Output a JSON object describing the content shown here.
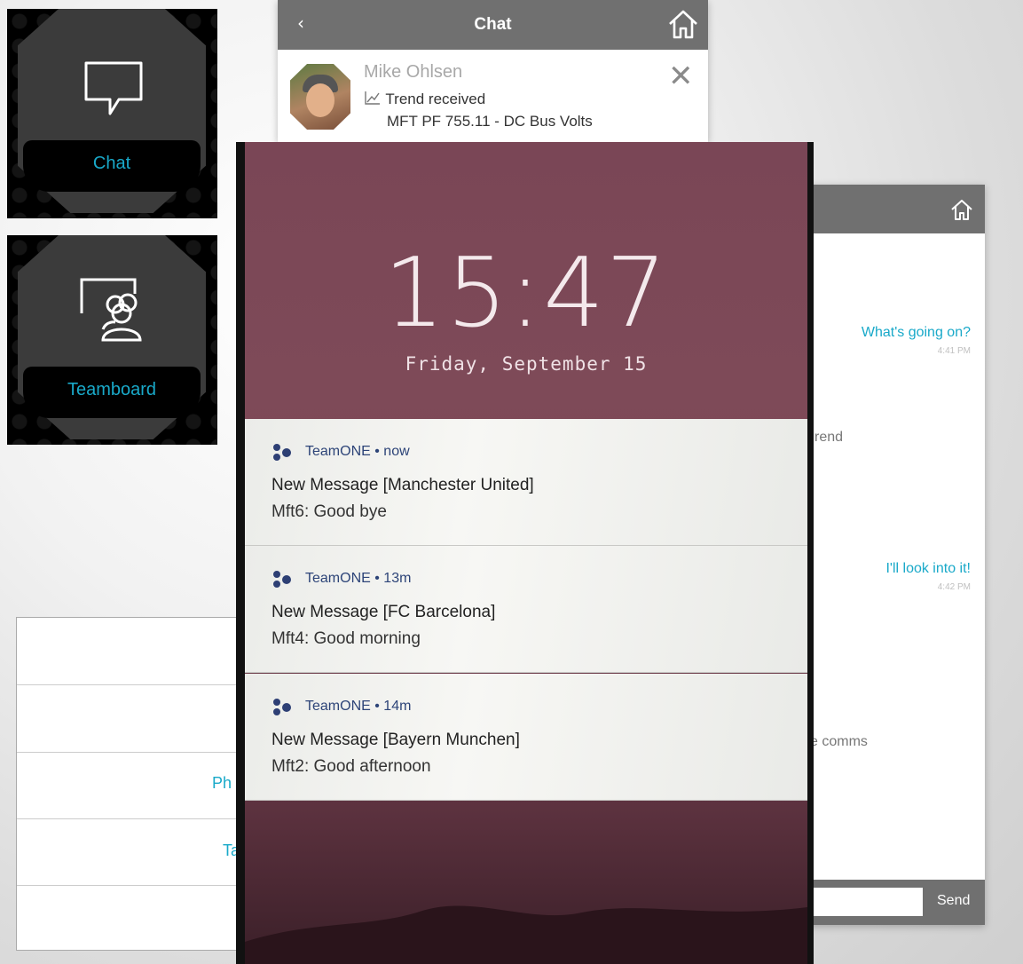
{
  "tiles": {
    "chat_label": "Chat",
    "teamboard_label": "Teamboard"
  },
  "chat_header": {
    "title": "Chat",
    "back_icon": "chevron-left-icon",
    "home_icon": "home-icon",
    "sender": "Mike Ohlsen",
    "trend_label": "Trend received",
    "trend_detail": "MFT PF 755.11 - DC Bus Volts",
    "close_icon": "close-icon"
  },
  "conversation": {
    "messages": [
      {
        "text": "What's going on?",
        "time": "4:41 PM"
      },
      {
        "text": "I'll look into it!",
        "time": "4:42 PM"
      }
    ],
    "partials": [
      "rend",
      "e comms"
    ],
    "send_label": "Send"
  },
  "list_panel": {
    "items": [
      "Ph",
      "Ta"
    ]
  },
  "lock_screen": {
    "time": "15:47",
    "date": "Friday, September 15",
    "notifications": [
      {
        "app": "TeamONE • now",
        "title": "New Message [Manchester United]",
        "body": "Mft6: Good bye"
      },
      {
        "app": "TeamONE • 13m",
        "title": "New Message [FC Barcelona]",
        "body": "Mft4: Good morning"
      },
      {
        "app": "TeamONE • 14m",
        "title": "New Message [Bayern Munchen]",
        "body": "Mft2: Good afternoon"
      }
    ]
  },
  "colors": {
    "accent": "#19a9c9",
    "header_gray": "#707070",
    "lockscreen": "#7a4656"
  }
}
